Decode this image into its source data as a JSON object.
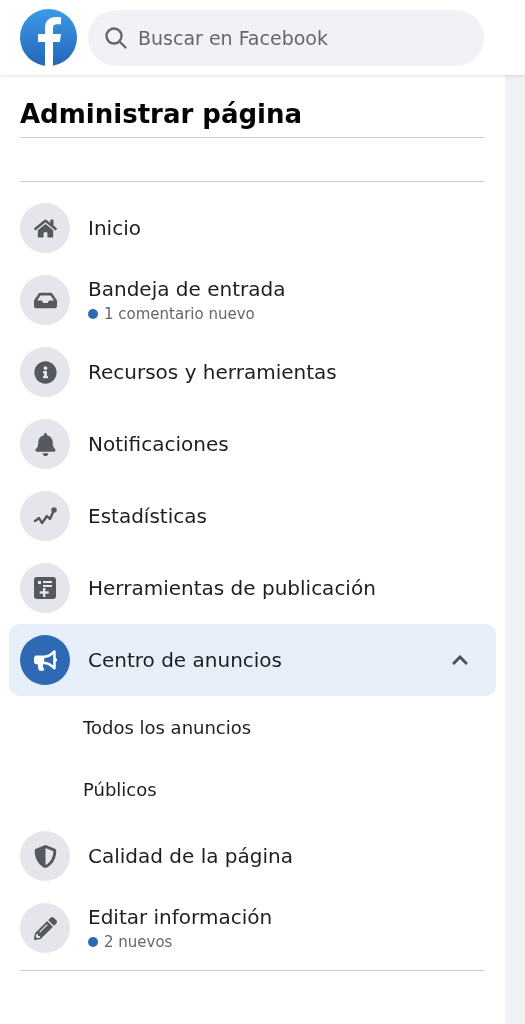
{
  "header": {
    "search": {
      "placeholder": "Buscar en Facebook"
    }
  },
  "sidebar": {
    "title": "Administrar página",
    "items": [
      {
        "kind": "link",
        "label": "Inicio",
        "selected": false
      },
      {
        "kind": "link",
        "label": "Bandeja de entrada",
        "subtitle": "1 comentario nuevo",
        "selected": false
      },
      {
        "kind": "link",
        "label": "Recursos y herramientas",
        "selected": false
      },
      {
        "kind": "link",
        "label": "Notificaciones",
        "selected": false
      },
      {
        "kind": "link",
        "label": "Estadísticas",
        "selected": false
      },
      {
        "kind": "link",
        "label": "Herramientas de publicación",
        "selected": false
      },
      {
        "kind": "group",
        "label": "Centro de anuncios",
        "selected": true,
        "expanded": true,
        "children": [
          {
            "label": "Todos los anuncios"
          },
          {
            "label": "Públicos"
          }
        ]
      },
      {
        "kind": "link",
        "label": "Calidad de la página",
        "selected": false
      },
      {
        "kind": "link",
        "label": "Editar información",
        "subtitle": "2 nuevos",
        "selected": false
      }
    ]
  }
}
